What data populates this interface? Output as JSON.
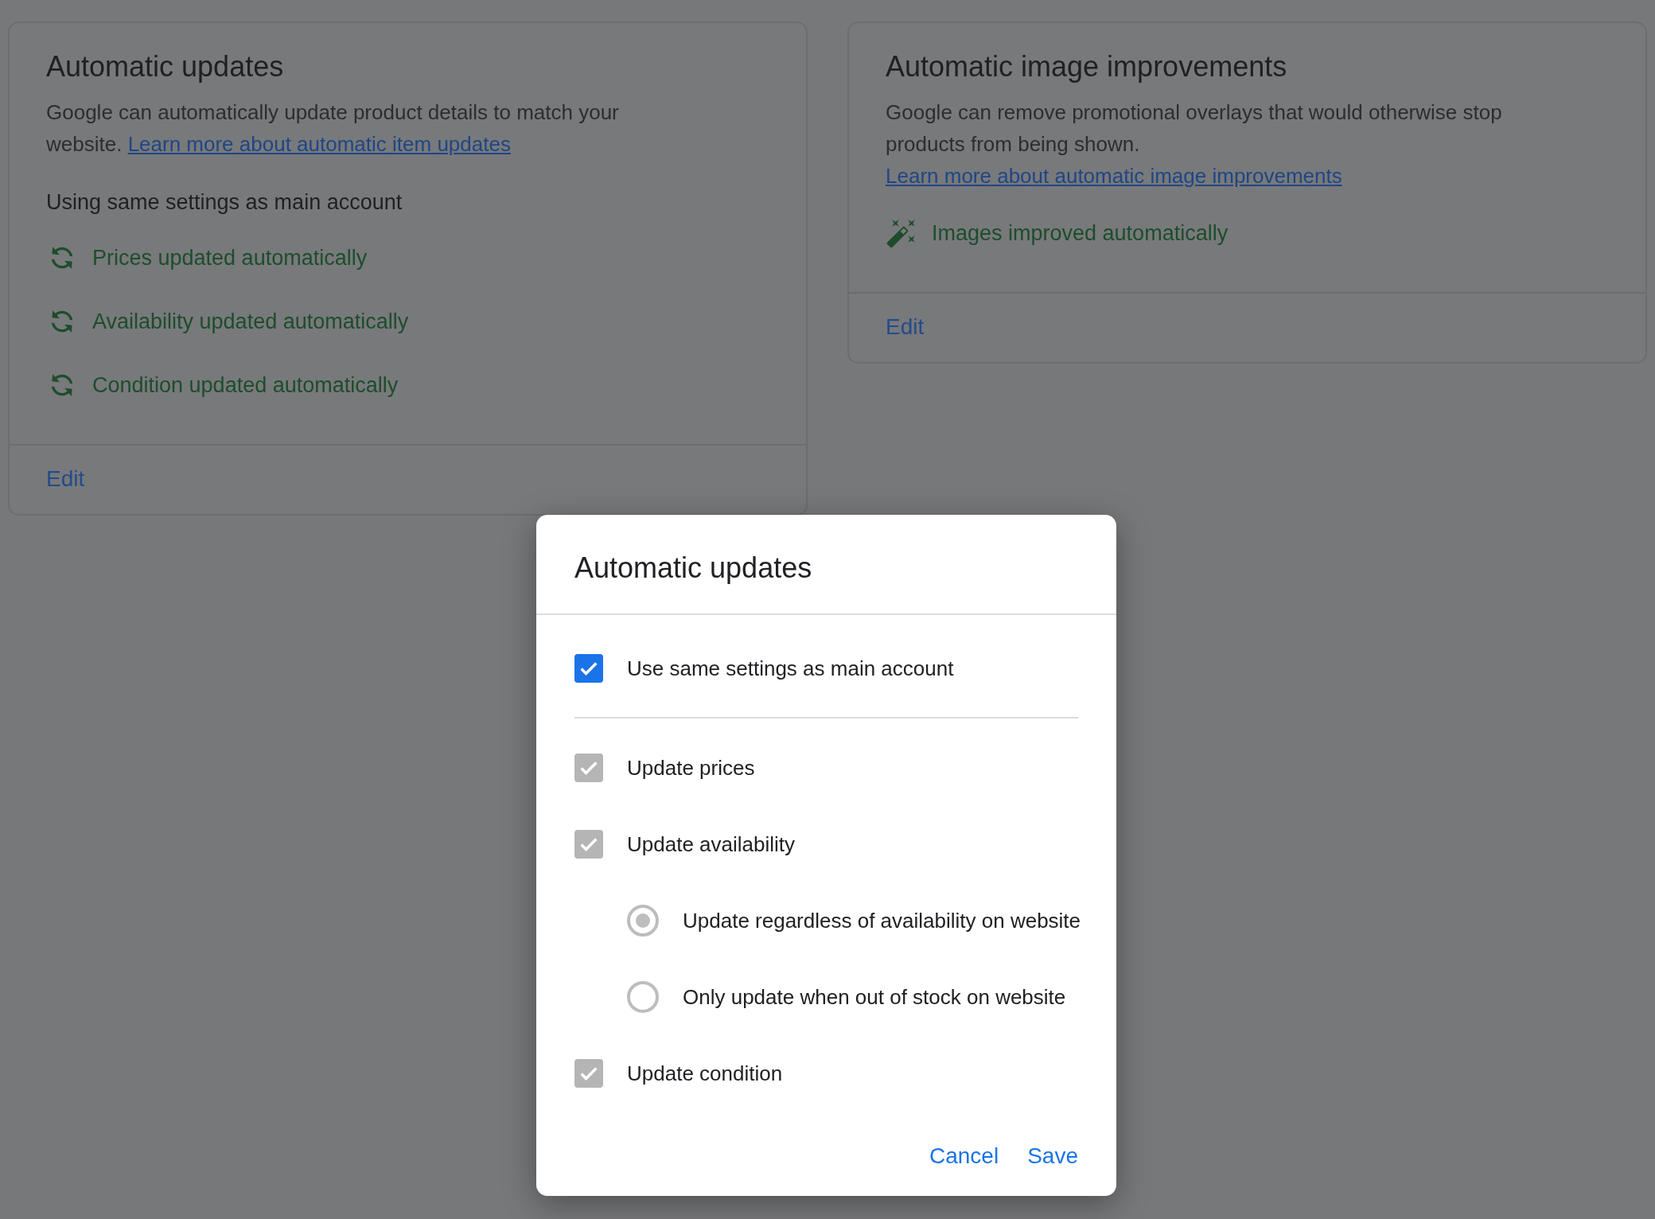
{
  "cards": [
    {
      "title": "Automatic updates",
      "description": "Google can automatically update product details to match your website.",
      "link": "Learn more about automatic item updates",
      "subtitle": "Using same settings as main account",
      "items": [
        {
          "kind": "sync",
          "text": "Prices updated automatically"
        },
        {
          "kind": "sync",
          "text": "Availability updated automatically"
        },
        {
          "kind": "sync",
          "text": "Condition updated automatically"
        }
      ],
      "action": "Edit"
    },
    {
      "title": "Automatic image improvements",
      "description": "Google can remove promotional overlays that would otherwise stop products from being shown.",
      "link": "Learn more about automatic image improvements",
      "items": [
        {
          "kind": "wand",
          "text": "Images improved automatically"
        }
      ],
      "action": "Edit"
    }
  ],
  "dialog": {
    "title": "Automatic updates",
    "main_option": {
      "label": "Use same settings as main account",
      "checked": true
    },
    "options": [
      {
        "label": "Update prices",
        "checked": true,
        "disabled": true
      },
      {
        "label": "Update availability",
        "checked": true,
        "disabled": true,
        "children": [
          {
            "label": "Update regardless of availability on website",
            "selected": true,
            "disabled": true
          },
          {
            "label": "Only update when out of stock on website",
            "selected": false,
            "disabled": true
          }
        ]
      },
      {
        "label": "Update condition",
        "checked": true,
        "disabled": true
      }
    ],
    "buttons": [
      "Cancel",
      "Save"
    ]
  }
}
